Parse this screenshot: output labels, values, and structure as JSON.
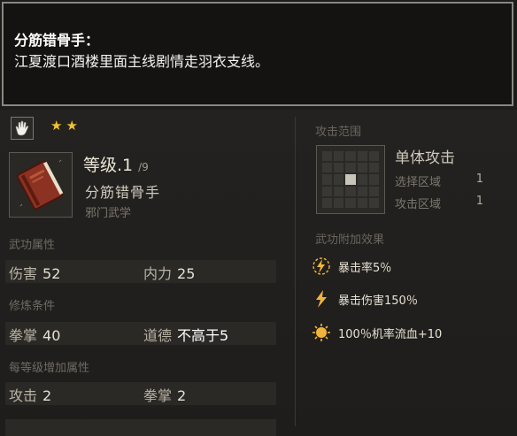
{
  "tooltip": {
    "title": "分筋错骨手：",
    "text": "江夏渡口酒楼里面主线剧情走羽衣支线。"
  },
  "skill": {
    "stars": [
      "★",
      "★"
    ],
    "level_label": "等级.1",
    "level_max": "/9",
    "name": "分筋错骨手",
    "type": "邪门武学"
  },
  "sections": {
    "attributes_label": "武功属性",
    "requirements_label": "修炼条件",
    "per_level_label": "每等级增加属性"
  },
  "attributes": [
    {
      "label": "伤害",
      "value": "52"
    },
    {
      "label": "内力",
      "value": "25"
    }
  ],
  "requirements": [
    {
      "label": "拳掌",
      "value": "40"
    },
    {
      "label": "道德",
      "value": "不高于5"
    }
  ],
  "per_level": [
    {
      "label": "攻击",
      "value": "2"
    },
    {
      "label": "拳掌",
      "value": "2"
    }
  ],
  "attack_range": {
    "label": "攻击范围",
    "type": "单体攻击",
    "select_area_label": "选择区域",
    "select_area_value": "1",
    "attack_area_label": "攻击区域",
    "attack_area_value": "1"
  },
  "effects_label": "武功附加效果",
  "effects": [
    {
      "icon": "crit-rate-icon",
      "text": "暴击率5％"
    },
    {
      "icon": "crit-damage-icon",
      "text": "暴击伤害150％"
    },
    {
      "icon": "bleed-icon",
      "text": "100％机率流血+10"
    }
  ],
  "colors": {
    "star": "#f1c232",
    "effect_icon": "#f0b43a"
  }
}
